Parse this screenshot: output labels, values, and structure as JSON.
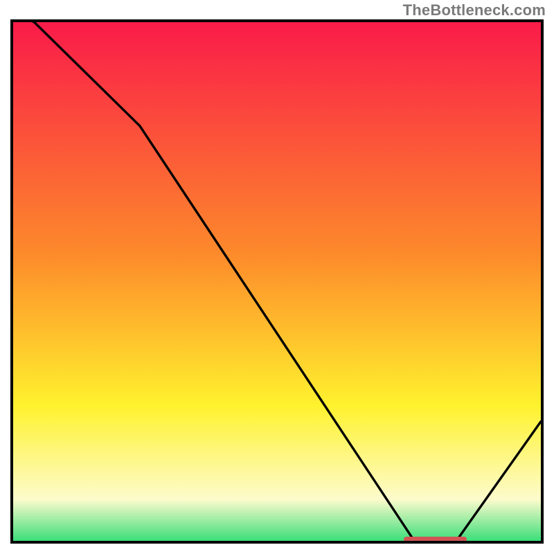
{
  "attribution": "TheBottleneck.com",
  "colors": {
    "gradient_top": "#fa1b49",
    "gradient_mid1": "#fd8b2b",
    "gradient_mid2": "#fff22e",
    "gradient_pale": "#fdfbcc",
    "gradient_bottom": "#3cde7a",
    "curve": "#000000",
    "marker": "#d15454",
    "border": "#000000"
  },
  "chart_data": {
    "type": "line",
    "title": "",
    "xlabel": "",
    "ylabel": "",
    "xlim": [
      0,
      100
    ],
    "ylim": [
      0,
      100
    ],
    "x": [
      0,
      4,
      24,
      76,
      84,
      100
    ],
    "values": [
      102,
      100,
      80,
      0,
      0,
      23
    ],
    "marker": {
      "x0": 74,
      "x1": 86,
      "y": 0
    },
    "annotations": []
  }
}
